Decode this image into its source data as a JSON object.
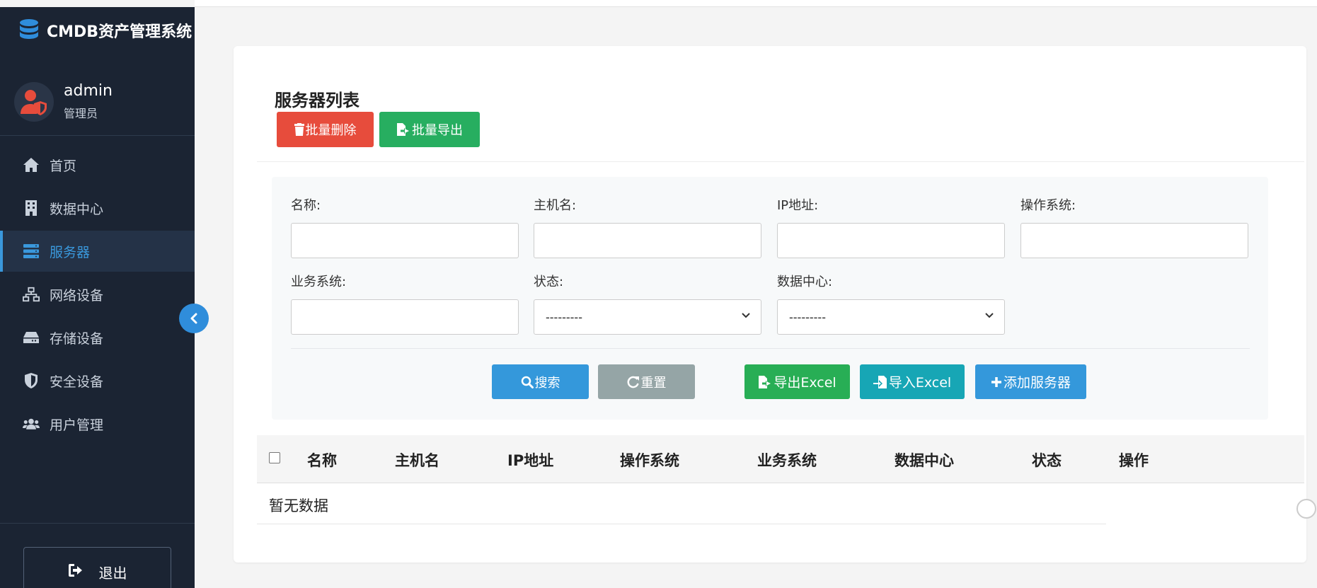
{
  "app": {
    "title": "CMDB资产管理系统"
  },
  "user": {
    "name": "admin",
    "role": "管理员"
  },
  "sidebar": {
    "items": [
      {
        "label": "首页",
        "icon": "home-icon"
      },
      {
        "label": "数据中心",
        "icon": "building-icon"
      },
      {
        "label": "服务器",
        "icon": "server-icon",
        "active": true
      },
      {
        "label": "网络设备",
        "icon": "network-icon"
      },
      {
        "label": "存储设备",
        "icon": "hdd-icon"
      },
      {
        "label": "安全设备",
        "icon": "shield-icon"
      },
      {
        "label": "用户管理",
        "icon": "users-icon"
      }
    ],
    "logout_label": "退出"
  },
  "main": {
    "title": "服务器列表",
    "batch_delete_label": "批量删除",
    "batch_export_label": "批量导出"
  },
  "filter": {
    "name_label": "名称:",
    "hostname_label": "主机名:",
    "ip_label": "IP地址:",
    "os_label": "操作系统:",
    "business_label": "业务系统:",
    "status_label": "状态:",
    "status_value": "---------",
    "datacenter_label": "数据中心:",
    "datacenter_value": "---------",
    "search_label": "搜索",
    "reset_label": "重置",
    "export_excel_label": "导出Excel",
    "import_excel_label": "导入Excel",
    "add_server_label": "添加服务器"
  },
  "table": {
    "columns": [
      "名称",
      "主机名",
      "IP地址",
      "操作系统",
      "业务系统",
      "数据中心",
      "状态",
      "操作"
    ],
    "empty_text": "暂无数据"
  },
  "colors": {
    "sidebar_bg": "#1b2433",
    "accent": "#3498db",
    "danger": "#e74c3c",
    "success": "#27ae60",
    "info": "#17a6b5",
    "muted": "#95a5a6"
  }
}
